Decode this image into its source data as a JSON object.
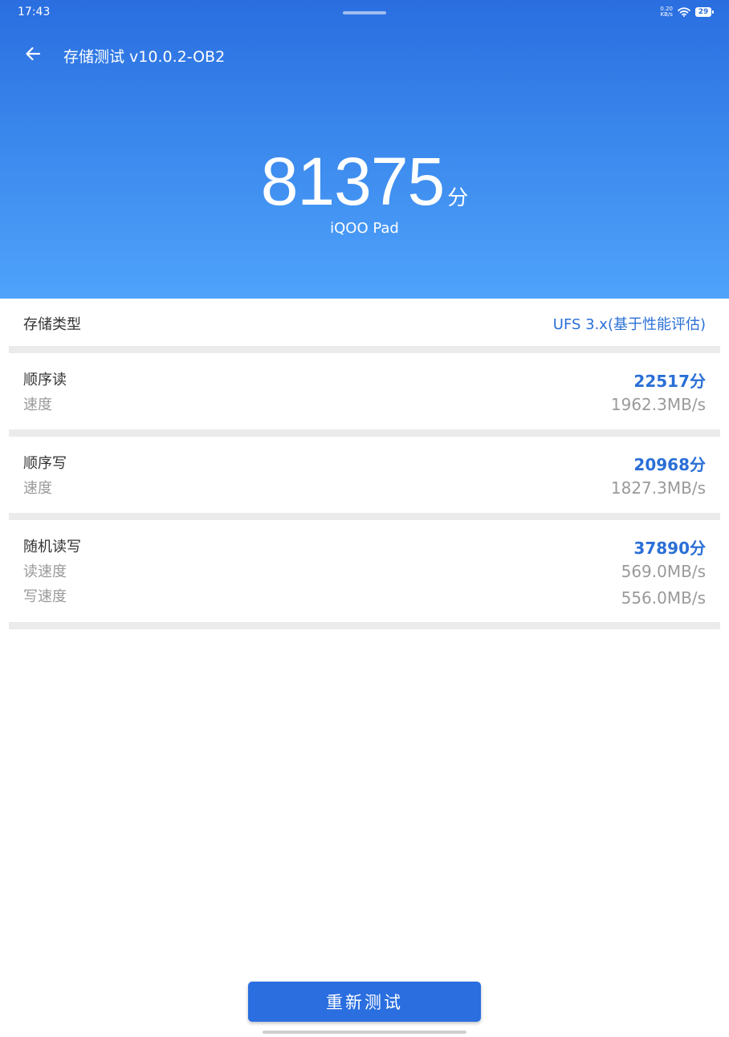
{
  "status_bar": {
    "time": "17:43",
    "net_speed_value": "0.20",
    "net_speed_unit": "KB/s",
    "battery": "29"
  },
  "header": {
    "title": "存储测试 v10.0.2-OB2"
  },
  "score": {
    "value": "81375",
    "unit": "分",
    "device": "iQOO Pad"
  },
  "storage_type": {
    "label": "存储类型",
    "value": "UFS 3.x(基于性能评估)"
  },
  "sequential_read": {
    "label": "顺序读",
    "speed_label": "速度",
    "score": "22517分",
    "speed": "1962.3MB/s"
  },
  "sequential_write": {
    "label": "顺序写",
    "speed_label": "速度",
    "score": "20968分",
    "speed": "1827.3MB/s"
  },
  "random_rw": {
    "label": "随机读写",
    "read_speed_label": "读速度",
    "write_speed_label": "写速度",
    "score": "37890分",
    "read_speed": "569.0MB/s",
    "write_speed": "556.0MB/s"
  },
  "actions": {
    "retest_label": "重新测试"
  },
  "colors": {
    "accent": "#2a6ee0",
    "value_blue": "#2a6fd6",
    "hero_bottom": "#4fa3fb"
  },
  "icons": {
    "back": "arrow-left-icon",
    "wifi": "wifi-icon",
    "battery": "battery-icon"
  }
}
